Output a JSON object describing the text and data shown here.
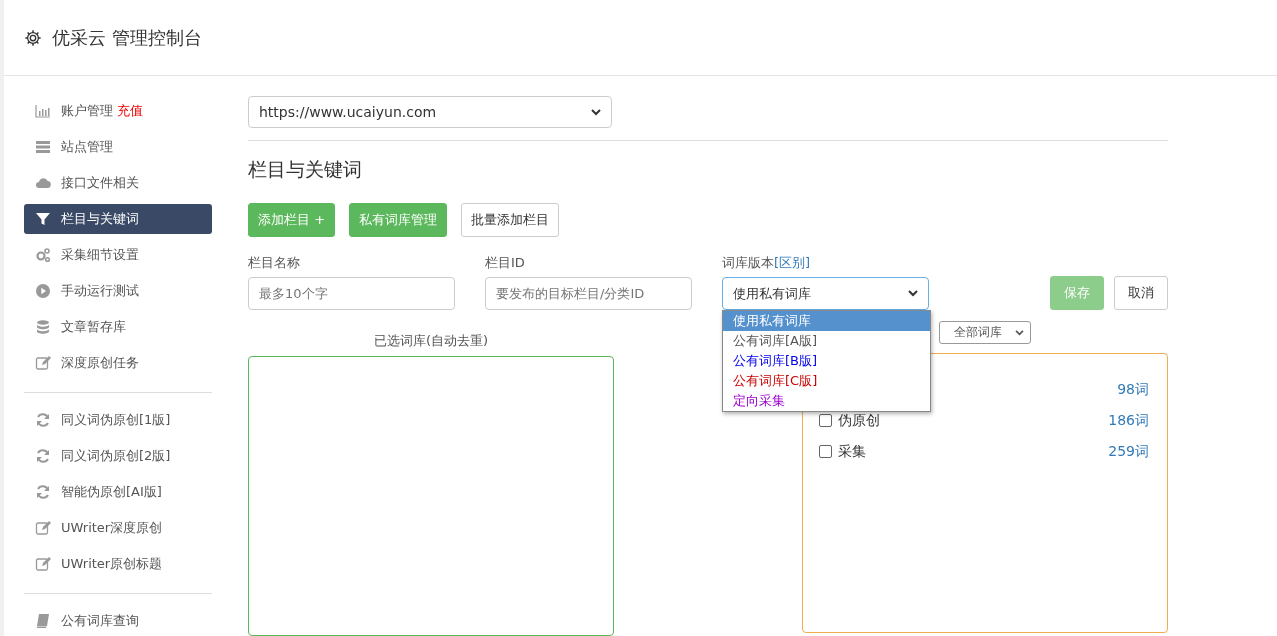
{
  "header": {
    "title": "优采云 管理控制台"
  },
  "sidebar": {
    "groups": [
      {
        "items": [
          {
            "label": "账户管理",
            "badge": "充值",
            "selected": false
          },
          {
            "label": "站点管理",
            "selected": false
          },
          {
            "label": "接口文件相关",
            "selected": false
          },
          {
            "label": "栏目与关键词",
            "selected": true
          },
          {
            "label": "采集细节设置",
            "selected": false
          },
          {
            "label": "手动运行测试",
            "selected": false
          },
          {
            "label": "文章暂存库",
            "selected": false
          },
          {
            "label": "深度原创任务",
            "selected": false
          }
        ]
      },
      {
        "items": [
          {
            "label": "同义词伪原创[1版]",
            "selected": false
          },
          {
            "label": "同义词伪原创[2版]",
            "selected": false
          },
          {
            "label": "智能伪原创[AI版]",
            "selected": false
          },
          {
            "label": "UWriter深度原创",
            "selected": false
          },
          {
            "label": "UWriter原创标题",
            "selected": false
          }
        ]
      },
      {
        "items": [
          {
            "label": "公有词库查询",
            "selected": false
          }
        ]
      }
    ]
  },
  "site_select": {
    "value": "https://www.ucaiyun.com"
  },
  "section_title": "栏目与关键词",
  "buttons": [
    {
      "label": "添加栏目 +",
      "kind": "primary"
    },
    {
      "label": "私有词库管理",
      "kind": "primary"
    },
    {
      "label": "批量添加栏目",
      "kind": "default"
    }
  ],
  "form": {
    "name": {
      "label": "栏目名称",
      "placeholder": "最多10个字"
    },
    "id": {
      "label": "栏目ID",
      "placeholder": "要发布的目标栏目/分类ID"
    },
    "library": {
      "label": "词库版本",
      "link": "[区别]",
      "value": "使用私有词库",
      "expanded": true,
      "options": [
        {
          "label": "使用私有词库",
          "selected": true
        },
        {
          "label": "公有词库[A版]",
          "selected": false,
          "color": "#555555"
        },
        {
          "label": "公有词库[B版]",
          "selected": false,
          "color": "#0000ee"
        },
        {
          "label": "公有词库[C版]",
          "selected": false,
          "color": "#cc0000"
        },
        {
          "label": "定向采集",
          "selected": false,
          "color": "#9900cc"
        }
      ]
    },
    "save": "保存",
    "cancel": "取消"
  },
  "selected_panel": {
    "title": "已选词库(自动去重)"
  },
  "library_filter": {
    "value": "全部词库"
  },
  "library_list": [
    {
      "count": "98词"
    },
    {
      "label": "伪原创",
      "count": "186词",
      "checked": false
    },
    {
      "label": "采集",
      "count": "259词",
      "checked": false
    }
  ]
}
